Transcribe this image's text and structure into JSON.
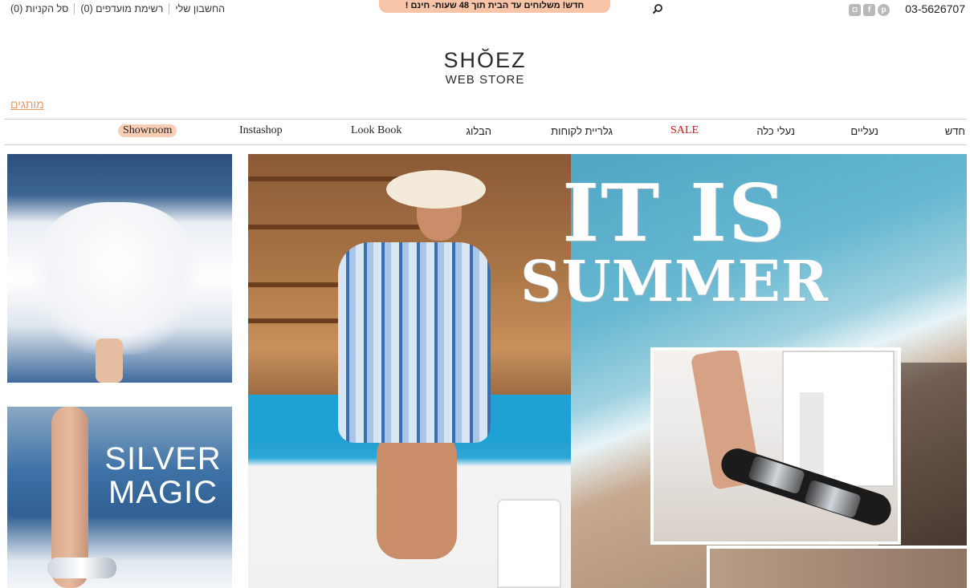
{
  "topbar": {
    "phone": "03-5626707",
    "social_icons": [
      "instagram-icon",
      "facebook-icon",
      "pinterest-icon"
    ],
    "promo": "חדש! משלוחים עד הבית תוך 48 שעות- חינם !",
    "links": {
      "account": "החשבון שלי",
      "wishlist": "רשימת מועדפים (0)",
      "cart": "סל הקניות (0)"
    }
  },
  "logo": {
    "main": "SHŎEZ",
    "sub": "WEB STORE"
  },
  "brands_link": "מותגים",
  "nav": {
    "new": "חדש",
    "shoes": "נעליים",
    "bridal": "נעלי כלה",
    "sale": "SALE",
    "gallery": "גלריית לקוחות",
    "blog": "הבלוג",
    "lookbook": "Look Book",
    "instashop": "Instashop",
    "showroom": "Showroom"
  },
  "banners": {
    "silver_line1": "SILVER",
    "silver_line2": "MAGIC",
    "summer_line1": "IT IS",
    "summer_line2": "SUMMER"
  },
  "colors": {
    "promo_bg": "#f7c4a8",
    "sale": "#c31a1a",
    "brands_link": "#e69a6a"
  }
}
